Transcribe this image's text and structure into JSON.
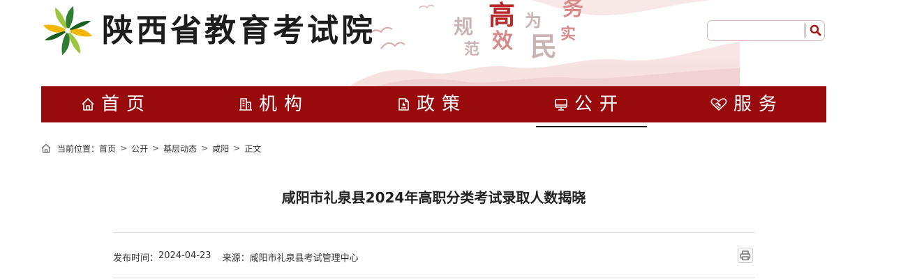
{
  "header": {
    "site_name": "陕西省教育考试院",
    "slogan": [
      "规",
      "范",
      "高",
      "效",
      "为",
      "民",
      "务",
      "实"
    ],
    "search": {
      "placeholder": "",
      "value": ""
    }
  },
  "nav": {
    "items": [
      {
        "label": "首页",
        "icon": "home-icon"
      },
      {
        "label": "机构",
        "icon": "building-icon"
      },
      {
        "label": "政策",
        "icon": "document-icon"
      },
      {
        "label": "公开",
        "icon": "monitor-icon",
        "active": true
      },
      {
        "label": "服务",
        "icon": "handshake-heart-icon"
      }
    ]
  },
  "breadcrumb": {
    "prefix": "当前位置：",
    "items": [
      "首页",
      "公开",
      "基层动态",
      "咸阳",
      "正文"
    ],
    "separator": ">"
  },
  "article": {
    "title": "咸阳市礼泉县2024年高职分类考试录取人数揭晓",
    "publish_label": "发布时间：",
    "publish_date": "2024-04-23",
    "source_label": "来源：",
    "source": "咸阳市礼泉县考试管理中心"
  },
  "colors": {
    "brand_red": "#990a0d",
    "slogan_red": "#b72a2a"
  }
}
